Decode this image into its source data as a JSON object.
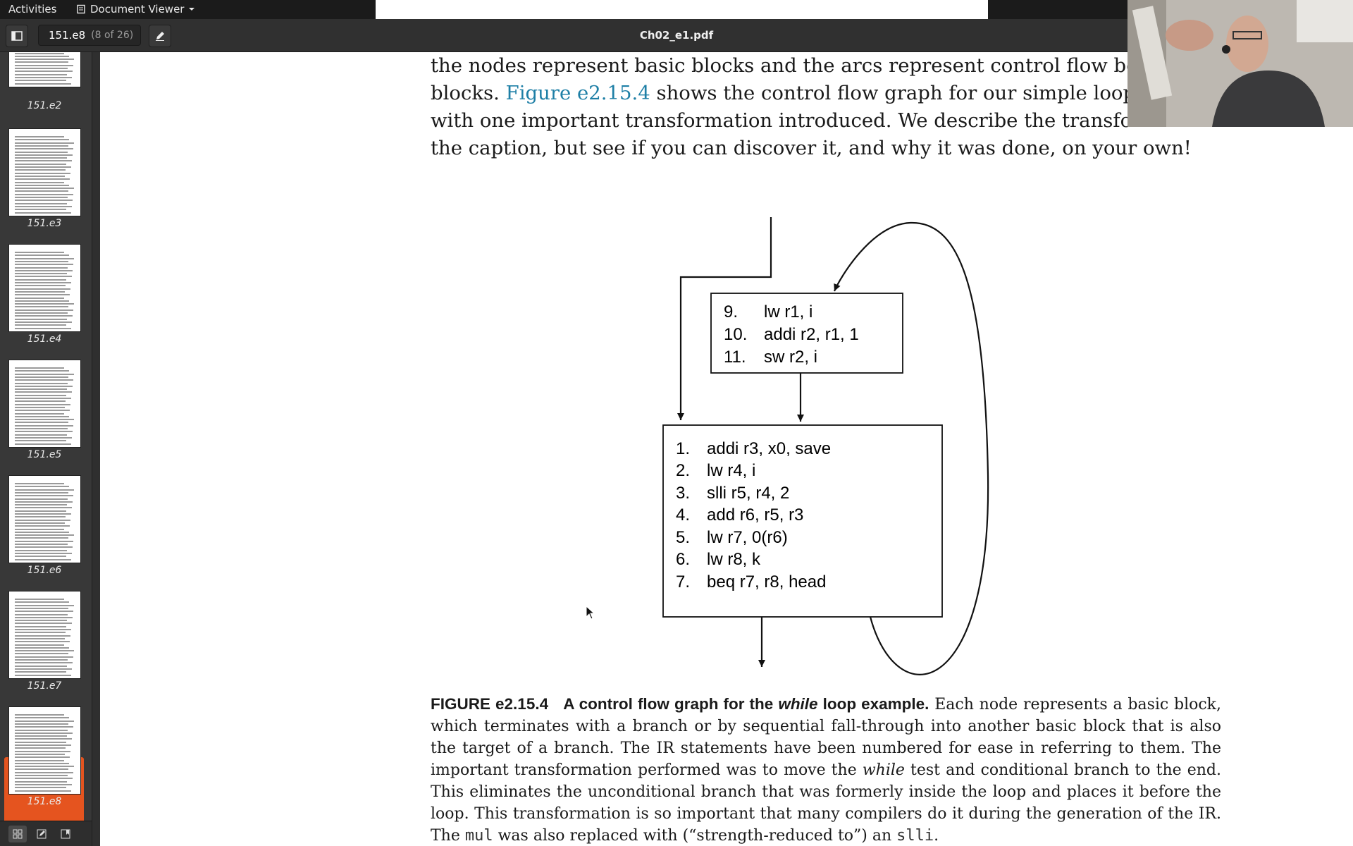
{
  "topbar": {
    "activities": "Activities",
    "app_menu": "Document Viewer"
  },
  "header": {
    "page_current": "151.e8",
    "page_of": "(8 of 26)",
    "title": "Ch02_e1.pdf"
  },
  "sidebar": {
    "thumbnails": [
      {
        "label": "151.e2"
      },
      {
        "label": "151.e3"
      },
      {
        "label": "151.e4"
      },
      {
        "label": "151.e5"
      },
      {
        "label": "151.e6"
      },
      {
        "label": "151.e7"
      },
      {
        "label": "151.e8",
        "selected": true
      }
    ],
    "selected_color": "#e5541f"
  },
  "document": {
    "intro_lines": [
      {
        "pre": "the nodes represent basic blocks and the arcs represent control flow betw",
        "link": "",
        "post": ""
      },
      {
        "pre": "blocks. ",
        "link": "Figure e2.15.4",
        "post": " shows the control flow graph for our simple loop"
      },
      {
        "pre": "with one important transformation introduced. We describe the transfor",
        "link": "",
        "post": ""
      },
      {
        "pre": "the caption, but see if you can discover it, and why it was done, on your own!",
        "link": "",
        "post": ""
      }
    ],
    "link_color": "#1e7fa6",
    "block_top": [
      {
        "num": "9.",
        "code": "lw r1, i"
      },
      {
        "num": "10.",
        "code": "addi r2, r1, 1"
      },
      {
        "num": "11.",
        "code": "sw r2, i"
      }
    ],
    "block_bottom": [
      {
        "num": "1.",
        "code": "addi r3, x0, save"
      },
      {
        "num": "2.",
        "code": "lw r4, i"
      },
      {
        "num": "3.",
        "code": "slli r5, r4, 2"
      },
      {
        "num": "4.",
        "code": "add r6, r5, r3"
      },
      {
        "num": "5.",
        "code": "lw r7, 0(r6)"
      },
      {
        "num": "6.",
        "code": "lw r8, k"
      },
      {
        "num": "7.",
        "code": "beq r7, r8, head"
      }
    ],
    "caption": {
      "figure_no": "FIGURE e2.15.4",
      "title_pre": "A control flow graph for the ",
      "title_em": "while",
      "title_post": " loop example.",
      "body_1": " Each node represents a basic block, which terminates with a branch or by sequential fall-through into another basic block that is also the target of a branch. The IR statements have been numbered for ease in referring to them. The important transformation performed was to move the ",
      "body_em": "while",
      "body_2": " test and conditional branch to the end. This eliminates the unconditional branch that was formerly inside the loop and places it before the loop. This transformation is so important that many compilers do it during the generation of the IR. The ",
      "mono_1": "mul",
      "body_3": " was also replaced with (“strength-reduced to”) an ",
      "mono_2": "slli",
      "body_4": "."
    }
  },
  "icons": {
    "sidebar_toggle": "sidebar-toggle-icon",
    "annotate": "pencil-icon",
    "thumbnails_view": "grid-icon",
    "annotations_view": "annotation-icon",
    "bookmarks_view": "bookmark-icon"
  }
}
